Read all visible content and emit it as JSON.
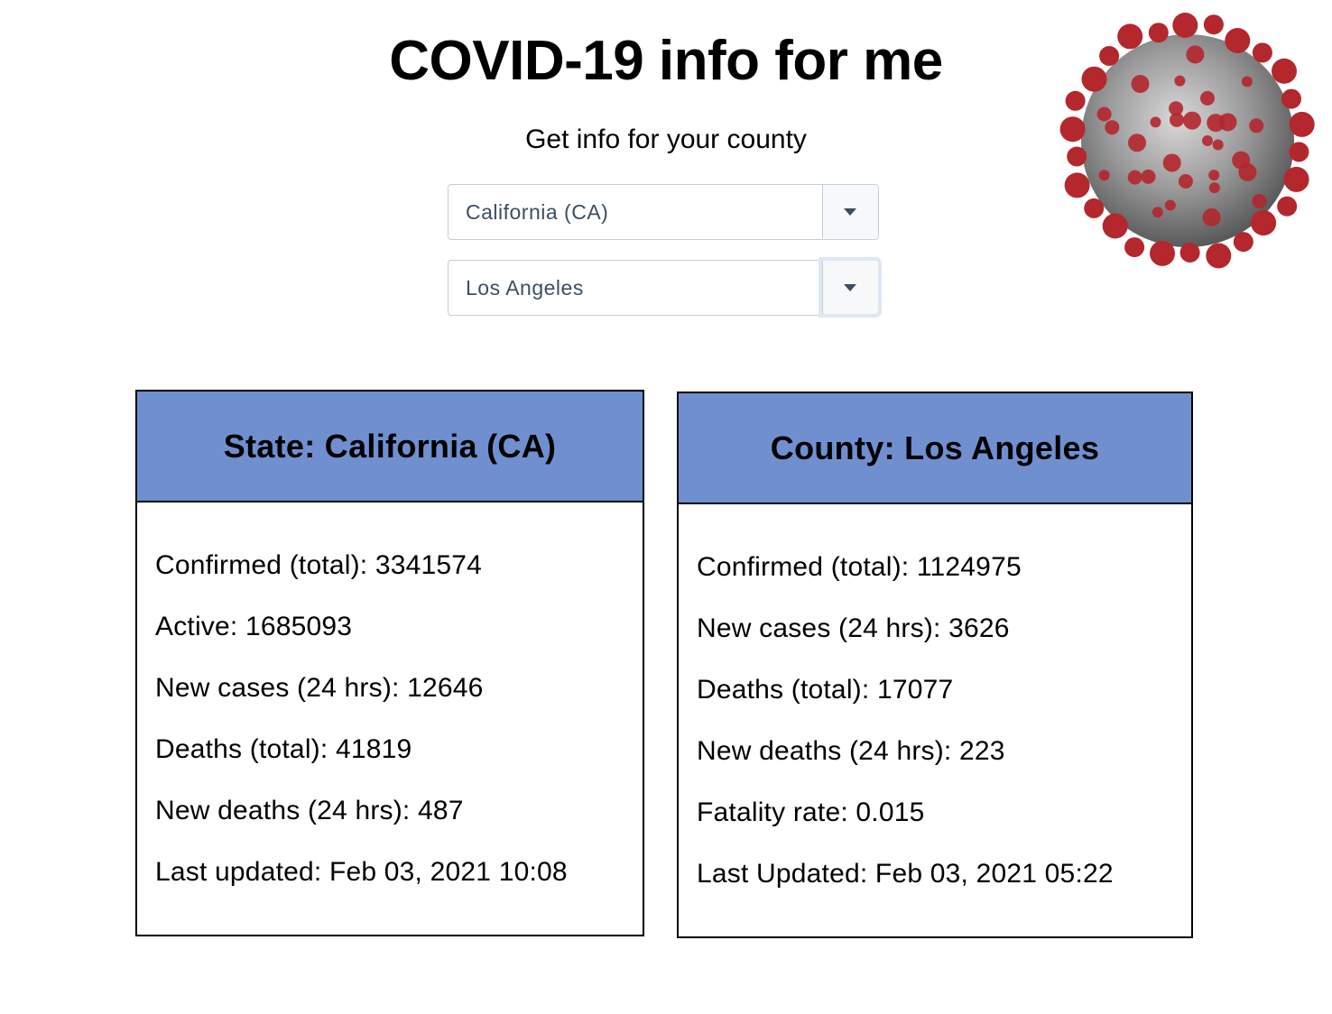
{
  "header": {
    "title": "COVID-19 info for me",
    "subtitle": "Get info for your county"
  },
  "selectors": {
    "state": {
      "value": "California (CA)"
    },
    "county": {
      "value": "Los Angeles"
    }
  },
  "state_card": {
    "heading": "State: California (CA)",
    "rows": [
      "Confirmed (total): 3341574",
      "Active: 1685093",
      "New cases (24 hrs): 12646",
      "Deaths (total): 41819",
      "New deaths (24 hrs): 487",
      "Last updated: Feb 03, 2021 10:08"
    ]
  },
  "county_card": {
    "heading": "County: Los Angeles",
    "rows": [
      "Confirmed (total): 1124975",
      "New cases (24 hrs): 3626",
      "Deaths (total): 17077",
      "New deaths (24 hrs): 223",
      "Fatality rate: 0.015",
      "Last Updated: Feb 03, 2021 05:22"
    ]
  },
  "icons": {
    "virus_image": "coronavirus-illustration",
    "dropdown_caret": "caret-down-icon"
  },
  "colors": {
    "card_header": "#6f8fcf",
    "virus_red": "#b3272d",
    "virus_gray": "#8a8a8a"
  }
}
